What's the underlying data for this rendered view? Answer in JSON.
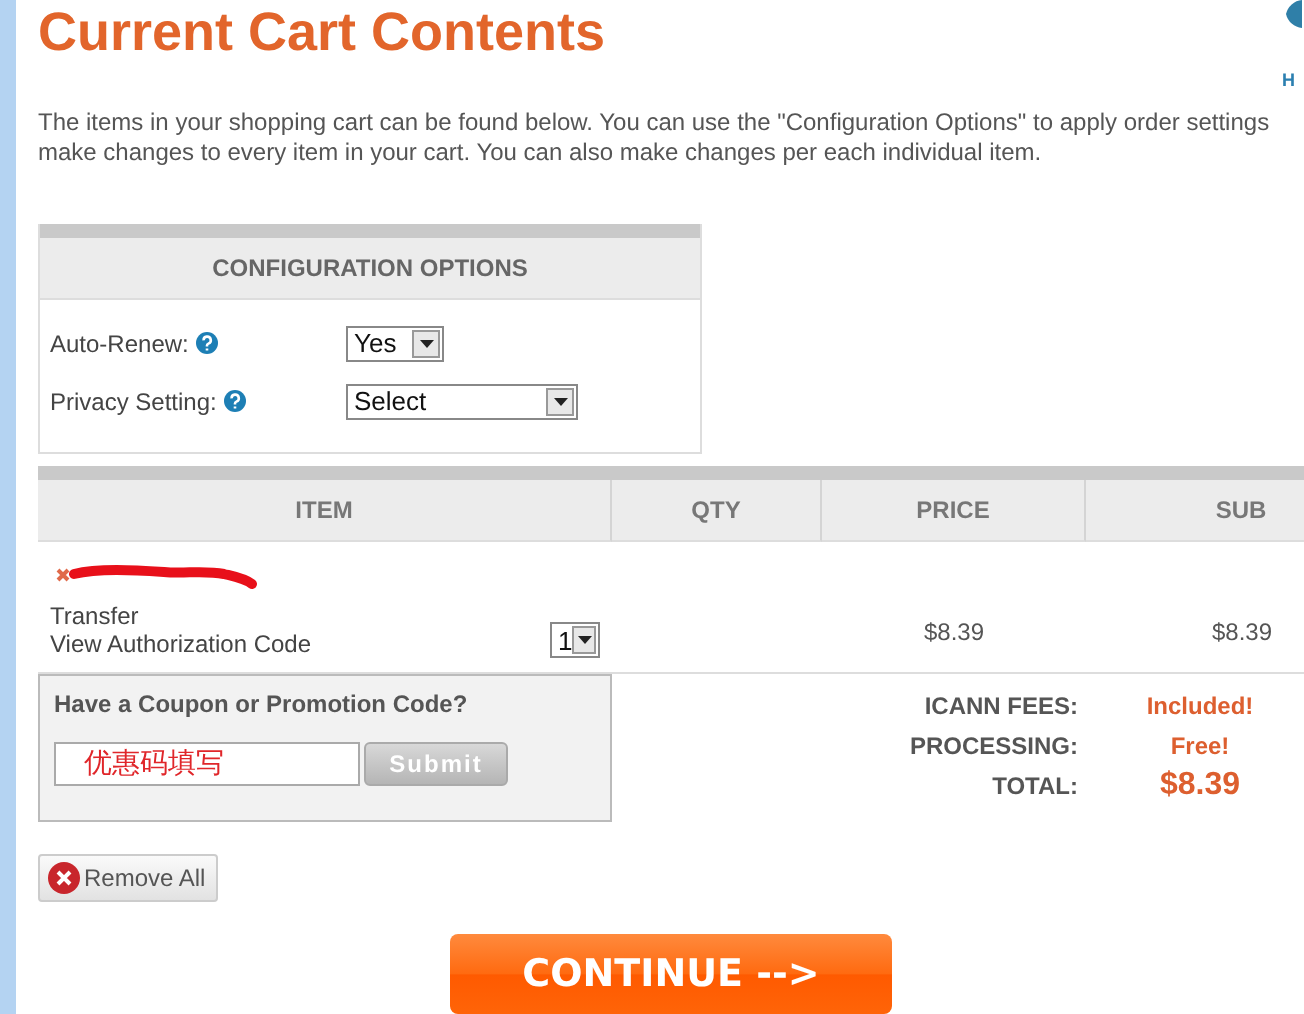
{
  "header": {
    "title": "Current Cart Contents",
    "help_label": "H"
  },
  "intro_lines": [
    "The items in your shopping cart can be found below. You can use the \"Configuration Options\" to apply order settings",
    "make changes to every item in your cart. You can also make changes per each individual item."
  ],
  "config": {
    "title": "CONFIGURATION OPTIONS",
    "options": [
      {
        "label": "Auto-Renew:",
        "value": "Yes"
      },
      {
        "label": "Privacy Setting:",
        "value": "Select"
      }
    ]
  },
  "table": {
    "columns": [
      "ITEM",
      "QTY",
      "PRICE",
      "SUB"
    ],
    "rows": [
      {
        "type": "Transfer",
        "link": "View Authorization Code",
        "qty": "1",
        "price": "$8.39",
        "sub": "$8.39"
      }
    ]
  },
  "coupon": {
    "title": "Have a Coupon or Promotion Code?",
    "value": "优惠码填写",
    "button": "Submit"
  },
  "totals": [
    {
      "label": "ICANN FEES:",
      "value": "Included!",
      "kind": "fee"
    },
    {
      "label": "PROCESSING:",
      "value": "Free!",
      "kind": "fee"
    },
    {
      "label": "TOTAL:",
      "value": "$8.39",
      "kind": "total"
    }
  ],
  "remove_button": "Remove All",
  "continue_button": "CONTINUE -->"
}
